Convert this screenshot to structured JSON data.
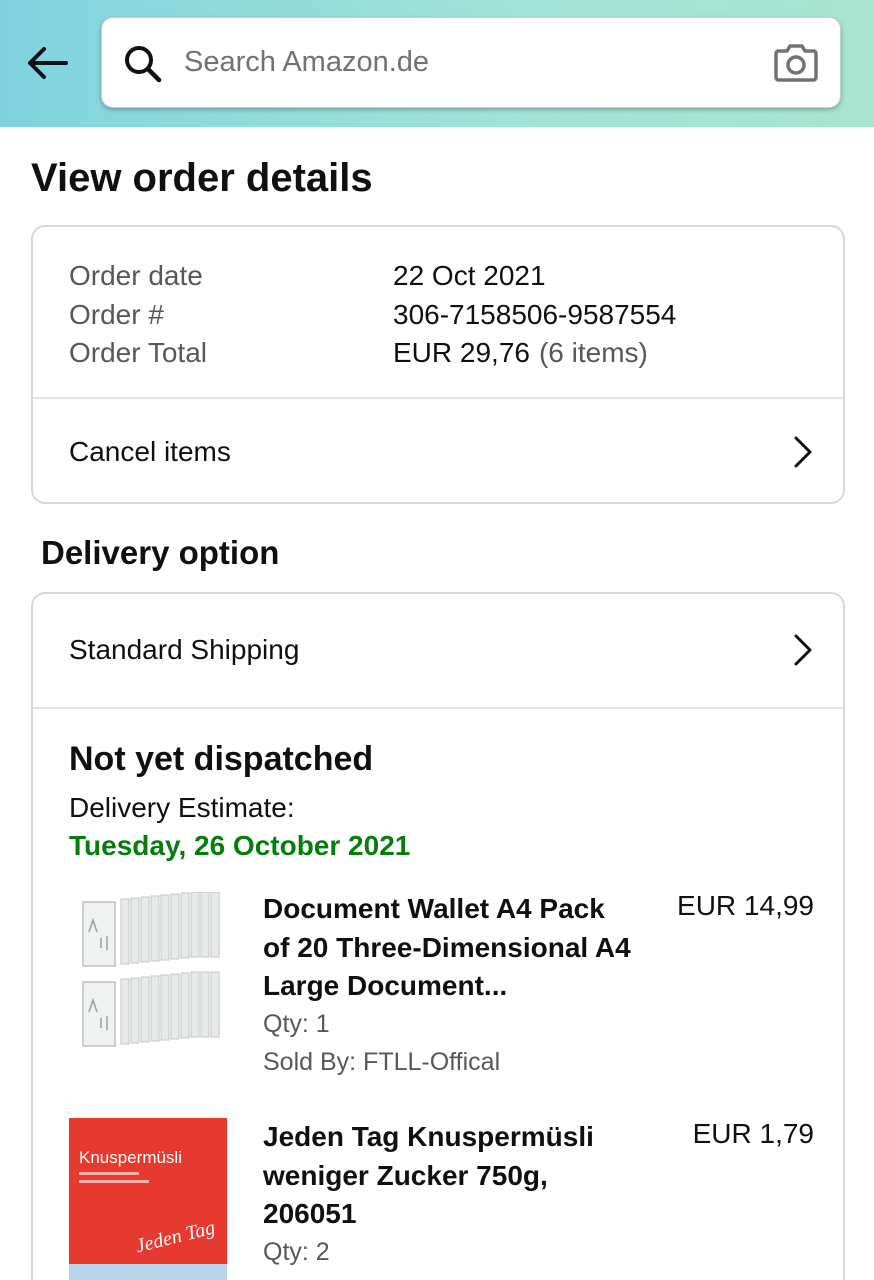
{
  "search": {
    "placeholder": "Search Amazon.de"
  },
  "page": {
    "title": "View order details"
  },
  "order": {
    "date_label": "Order date",
    "date_value": "22 Oct 2021",
    "number_label": "Order #",
    "number_value": "306-7158506-9587554",
    "total_label": "Order Total",
    "total_value": "EUR 29,76",
    "total_items": "(6 items)",
    "cancel_label": "Cancel items"
  },
  "delivery": {
    "section_title": "Delivery option",
    "shipping_label": "Standard Shipping",
    "status": "Not yet dispatched",
    "estimate_label": "Delivery Estimate:",
    "estimate_date": "Tuesday, 26 October 2021",
    "estimate_color": "#067d0e"
  },
  "items": [
    {
      "title": "Document Wallet A4 Pack of 20 Three-Dimensional A4 Large Document...",
      "price": "EUR 14,99",
      "qty": "Qty: 1",
      "sold_by": "Sold By: FTLL-Offical",
      "icon": "document-wallet-product-image"
    },
    {
      "title": "Jeden Tag Knuspermüsli weniger Zucker 750g, 206051",
      "price": "EUR 1,79",
      "qty": "Qty: 2",
      "package_brand": "Knuspermüsli",
      "package_logo": "Jeden Tag",
      "icon": "muesli-product-image"
    }
  ],
  "colors": {
    "header_gradient_start": "#7fd3de",
    "header_gradient_end": "#a8e4cf",
    "card_border": "#d5d9d9",
    "muted_text": "#565959"
  }
}
